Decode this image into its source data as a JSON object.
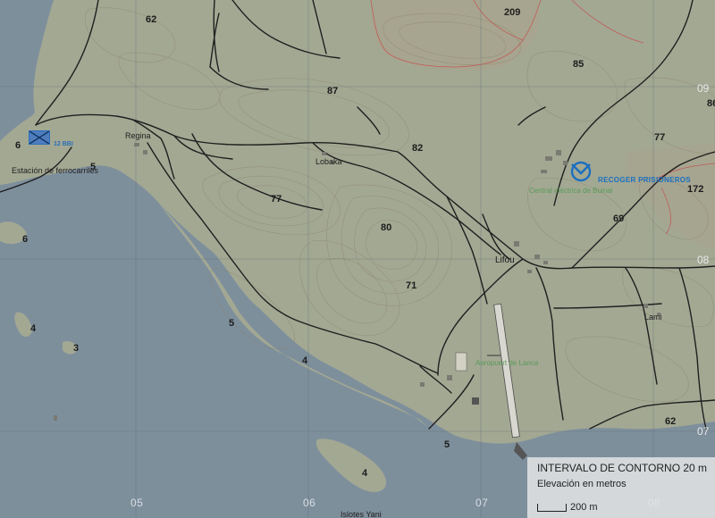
{
  "map": {
    "elevations": {
      "e62a": "62",
      "e209": "209",
      "e85": "85",
      "e87": "87",
      "e82": "82",
      "e77a": "77",
      "e77b": "77",
      "e172": "172",
      "e69": "69",
      "e80": "80",
      "e71": "71",
      "e6a": "6",
      "e6b": "6",
      "e5a": "5",
      "e5b": "5",
      "e4a": "4",
      "e4b": "4",
      "e4c": "4",
      "e3": "3",
      "e5c": "5",
      "e62b": "62",
      "e86": "86"
    },
    "places": {
      "regina": "Regina",
      "lobaka": "Lobaka",
      "lifou": "Lifou",
      "lami": "Lami",
      "station": "Estación de ferrocarriles",
      "airport": "Aeropuert de Lanca",
      "central": "Central eléctrica de Buinal",
      "islets": "Islotes Yani"
    },
    "unit_label": "12 BBI",
    "objective": "RECOGER PRISIONEROS",
    "grid_x": {
      "g05": "05",
      "g06": "06",
      "g07": "07",
      "g08": "08"
    },
    "grid_y": {
      "g09": "09",
      "g08": "08",
      "g07": "07"
    }
  },
  "legend": {
    "contour_interval": "INTERVALO DE CONTORNO 20 m",
    "elevation_unit": "Elevación en metros",
    "scale": "200 m"
  },
  "colors": {
    "water": "#7e8f9c",
    "land": "#a3a893",
    "road": "#1f1f1f",
    "contour": "#8a7f66",
    "high_contour": "#c84a4a",
    "objective": "#1a6fc0",
    "unit_marker": "#2b6fb8"
  },
  "icons": {
    "unit": "infantry-unit-icon",
    "objective": "objective-marker-icon"
  }
}
